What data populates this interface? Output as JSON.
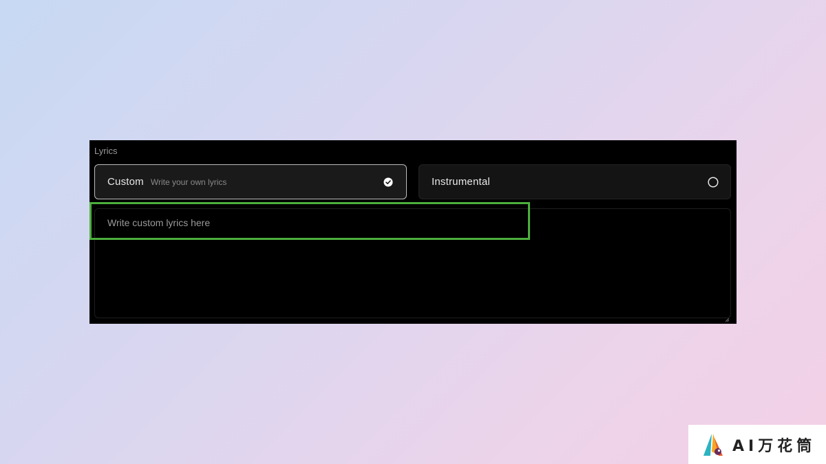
{
  "lyrics": {
    "section_label": "Lyrics",
    "options": [
      {
        "title": "Custom",
        "description": "Write your own lyrics",
        "selected": true,
        "indicator_icon": "check-circle-icon"
      },
      {
        "title": "Instrumental",
        "description": "",
        "selected": false,
        "indicator_icon": "radio-empty-icon"
      }
    ],
    "input": {
      "value": "",
      "placeholder": "Write custom lyrics here"
    }
  },
  "highlight": {
    "color": "#4caf3c",
    "target": "lyrics-input"
  },
  "watermark": {
    "text": "AI万花筒",
    "icon": "brand-logo-icon"
  },
  "colors": {
    "panel_background": "#000000",
    "selected_border": "#bdbdbd",
    "highlight": "#4caf3c"
  }
}
